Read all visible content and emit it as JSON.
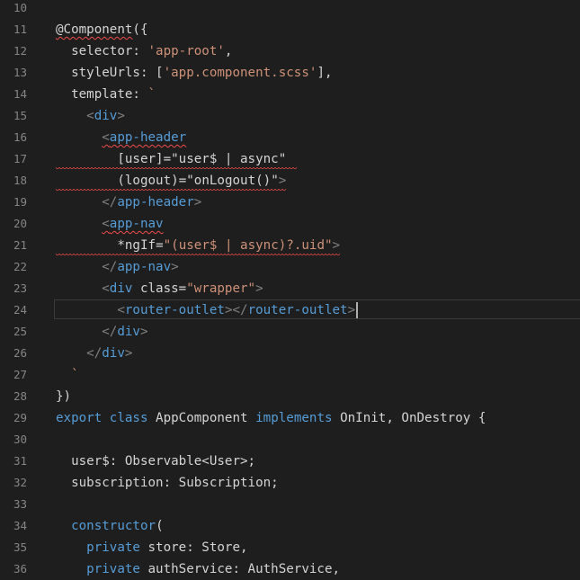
{
  "editor": {
    "language": "typescript",
    "lines": [
      {
        "n": "10",
        "tokens": []
      },
      {
        "n": "11",
        "tokens": [
          {
            "t": "@Component",
            "c": "t-dec",
            "sq": true
          },
          {
            "t": "({",
            "c": "t-punc"
          }
        ]
      },
      {
        "n": "12",
        "tokens": [
          {
            "t": "  selector: ",
            "c": "t-prop"
          },
          {
            "t": "'app-root'",
            "c": "t-str"
          },
          {
            "t": ",",
            "c": "t-punc"
          }
        ]
      },
      {
        "n": "13",
        "tokens": [
          {
            "t": "  styleUrls: [",
            "c": "t-prop"
          },
          {
            "t": "'app.component.scss'",
            "c": "t-str"
          },
          {
            "t": "],",
            "c": "t-punc"
          }
        ]
      },
      {
        "n": "14",
        "tokens": [
          {
            "t": "  template: ",
            "c": "t-prop"
          },
          {
            "t": "`",
            "c": "t-str"
          }
        ]
      },
      {
        "n": "15",
        "tokens": [
          {
            "t": "    ",
            "c": "t-punc"
          },
          {
            "t": "<",
            "c": "t-tagx"
          },
          {
            "t": "div",
            "c": "t-tag"
          },
          {
            "t": ">",
            "c": "t-tagx"
          }
        ]
      },
      {
        "n": "16",
        "tokens": [
          {
            "t": "      ",
            "c": "t-punc"
          },
          {
            "t": "<",
            "c": "t-tagx",
            "sq": true
          },
          {
            "t": "app-header",
            "c": "t-tag",
            "sq": true
          }
        ]
      },
      {
        "n": "17",
        "tokens": [
          {
            "t": "        ",
            "c": "t-punc"
          },
          {
            "t": "[user]",
            "c": "t-attr"
          },
          {
            "t": "=",
            "c": "t-punc"
          },
          {
            "t": "\"user$ | async\"",
            "c": "t-punc"
          }
        ]
      },
      {
        "n": "18",
        "tokens": [
          {
            "t": "        ",
            "c": "t-punc"
          },
          {
            "t": "(logout)",
            "c": "t-attr"
          },
          {
            "t": "=",
            "c": "t-punc"
          },
          {
            "t": "\"onLogout()\"",
            "c": "t-punc"
          },
          {
            "t": ">",
            "c": "t-tagx"
          }
        ]
      },
      {
        "n": "19",
        "tokens": [
          {
            "t": "      ",
            "c": "t-punc"
          },
          {
            "t": "</",
            "c": "t-tagx"
          },
          {
            "t": "app-header",
            "c": "t-tag"
          },
          {
            "t": ">",
            "c": "t-tagx"
          }
        ]
      },
      {
        "n": "20",
        "tokens": [
          {
            "t": "      ",
            "c": "t-punc"
          },
          {
            "t": "<",
            "c": "t-tagx",
            "sq": true
          },
          {
            "t": "app-nav",
            "c": "t-tag",
            "sq": true
          }
        ]
      },
      {
        "n": "21",
        "tokens": [
          {
            "t": "        ",
            "c": "t-punc"
          },
          {
            "t": "*ngIf",
            "c": "t-attr"
          },
          {
            "t": "=",
            "c": "t-punc"
          },
          {
            "t": "\"(user$ | async)?.uid\"",
            "c": "t-str"
          },
          {
            "t": ">",
            "c": "t-tagx"
          }
        ]
      },
      {
        "n": "22",
        "tokens": [
          {
            "t": "      ",
            "c": "t-punc"
          },
          {
            "t": "</",
            "c": "t-tagx"
          },
          {
            "t": "app-nav",
            "c": "t-tag"
          },
          {
            "t": ">",
            "c": "t-tagx"
          }
        ]
      },
      {
        "n": "23",
        "tokens": [
          {
            "t": "      ",
            "c": "t-punc"
          },
          {
            "t": "<",
            "c": "t-tagx"
          },
          {
            "t": "div",
            "c": "t-tag"
          },
          {
            "t": " class",
            "c": "t-attr"
          },
          {
            "t": "=",
            "c": "t-punc"
          },
          {
            "t": "\"wrapper\"",
            "c": "t-str"
          },
          {
            "t": ">",
            "c": "t-tagx"
          }
        ]
      },
      {
        "n": "24",
        "tokens": [
          {
            "t": "        ",
            "c": "t-punc"
          },
          {
            "t": "<",
            "c": "t-tagx"
          },
          {
            "t": "router-outlet",
            "c": "t-tag"
          },
          {
            "t": "></",
            "c": "t-tagx"
          },
          {
            "t": "router-outlet",
            "c": "t-tag"
          },
          {
            "t": ">",
            "c": "t-tagx"
          }
        ],
        "cursor": true
      },
      {
        "n": "25",
        "tokens": [
          {
            "t": "      ",
            "c": "t-punc"
          },
          {
            "t": "</",
            "c": "t-tagx"
          },
          {
            "t": "div",
            "c": "t-tag"
          },
          {
            "t": ">",
            "c": "t-tagx"
          }
        ]
      },
      {
        "n": "26",
        "tokens": [
          {
            "t": "    ",
            "c": "t-punc"
          },
          {
            "t": "</",
            "c": "t-tagx"
          },
          {
            "t": "div",
            "c": "t-tag"
          },
          {
            "t": ">",
            "c": "t-tagx"
          }
        ]
      },
      {
        "n": "27",
        "tokens": [
          {
            "t": "  ",
            "c": "t-punc"
          },
          {
            "t": "`",
            "c": "t-str"
          }
        ]
      },
      {
        "n": "28",
        "tokens": [
          {
            "t": "})",
            "c": "t-punc"
          }
        ]
      },
      {
        "n": "29",
        "tokens": [
          {
            "t": "export",
            "c": "t-kw"
          },
          {
            "t": " ",
            "c": "t-punc"
          },
          {
            "t": "class",
            "c": "t-kw"
          },
          {
            "t": " AppComponent ",
            "c": "t-cls"
          },
          {
            "t": "implements",
            "c": "t-kw"
          },
          {
            "t": " OnInit, OnDestroy {",
            "c": "t-type"
          }
        ]
      },
      {
        "n": "30",
        "tokens": []
      },
      {
        "n": "31",
        "tokens": [
          {
            "t": "  user$: Observable<User>;",
            "c": "t-prop"
          }
        ]
      },
      {
        "n": "32",
        "tokens": [
          {
            "t": "  subscription: Subscription;",
            "c": "t-prop"
          }
        ]
      },
      {
        "n": "33",
        "tokens": []
      },
      {
        "n": "34",
        "tokens": [
          {
            "t": "  ",
            "c": "t-punc"
          },
          {
            "t": "constructor",
            "c": "t-kw"
          },
          {
            "t": "(",
            "c": "t-punc"
          }
        ]
      },
      {
        "n": "35",
        "tokens": [
          {
            "t": "    ",
            "c": "t-punc"
          },
          {
            "t": "private",
            "c": "t-kw"
          },
          {
            "t": " store: Store,",
            "c": "t-prop"
          }
        ]
      },
      {
        "n": "36",
        "tokens": [
          {
            "t": "    ",
            "c": "t-punc"
          },
          {
            "t": "private",
            "c": "t-kw"
          },
          {
            "t": " authService: AuthService,",
            "c": "t-prop"
          }
        ]
      }
    ]
  },
  "colors": {
    "background": "#1e1e1e",
    "line_number": "#858585",
    "text": "#d4d4d4",
    "string": "#ce9178",
    "keyword": "#569cd6",
    "tag_bracket": "#808080",
    "error_squiggle": "#f14c4c"
  }
}
